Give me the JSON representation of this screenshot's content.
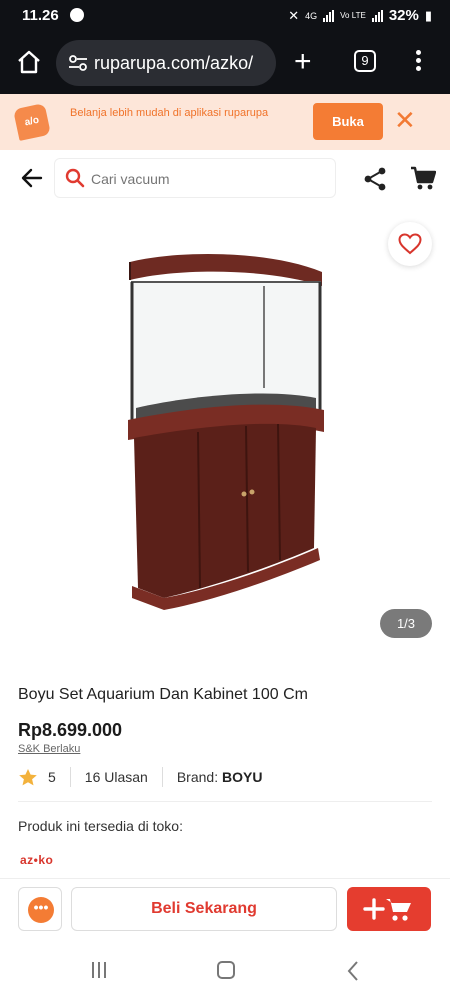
{
  "status_bar": {
    "time": "11.26",
    "network": "4G",
    "network2": "Vo LTE",
    "battery": "32%"
  },
  "browser": {
    "url": "ruparupa.com/azko/",
    "tab_count": "9"
  },
  "app_banner": {
    "logo_text": "a/o",
    "message": "Belanja lebih mudah di aplikasi ruparupa",
    "open_label": "Buka"
  },
  "header": {
    "search_placeholder": "Cari vacuum"
  },
  "gallery": {
    "counter": "1/3"
  },
  "product": {
    "title": "Boyu Set Aquarium Dan Kabinet 100 Cm",
    "price": "Rp8.699.000",
    "terms": "S&K Berlaku",
    "rating": "5",
    "reviews": "16 Ulasan",
    "brand_label": "Brand:",
    "brand": "BOYU",
    "availability": "Produk ini tersedia di toko:",
    "store": "az•ko"
  },
  "actions": {
    "buy_label": "Beli Sekarang",
    "chat_icon": "chat-icon",
    "add_cart_icon": "add-to-cart-icon"
  },
  "colors": {
    "accent": "#f47c34",
    "primary_red": "#e53d2f",
    "banner_bg": "#fde6d9"
  }
}
